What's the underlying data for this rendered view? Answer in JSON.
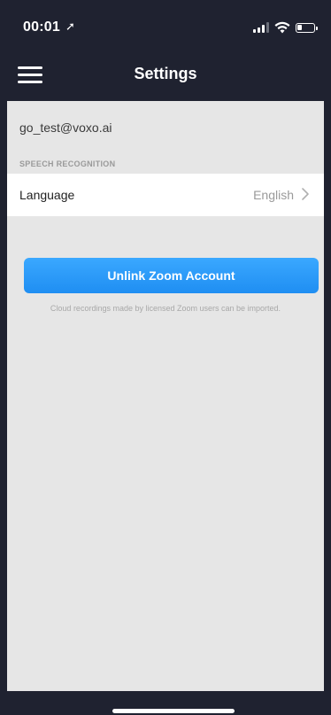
{
  "status_bar": {
    "time": "00:01",
    "location_icon": "location-arrow-icon",
    "signal_icon": "cellular-signal-icon",
    "wifi_icon": "wifi-icon",
    "battery_icon": "battery-icon"
  },
  "navbar": {
    "menu_icon": "hamburger-menu-icon",
    "title": "Settings"
  },
  "account": {
    "email": "go_test@voxo.ai"
  },
  "speech_recognition": {
    "section_title": "SPEECH RECOGNITION",
    "language_label": "Language",
    "language_value": "English",
    "chevron_icon": "chevron-right-icon"
  },
  "zoom": {
    "unlink_label": "Unlink Zoom Account",
    "helper_text": "Cloud recordings made by licensed Zoom users can be imported."
  },
  "colors": {
    "navbar_bg": "#1f2230",
    "content_bg": "#e6e6e6",
    "accent": "#2b9bf8"
  }
}
